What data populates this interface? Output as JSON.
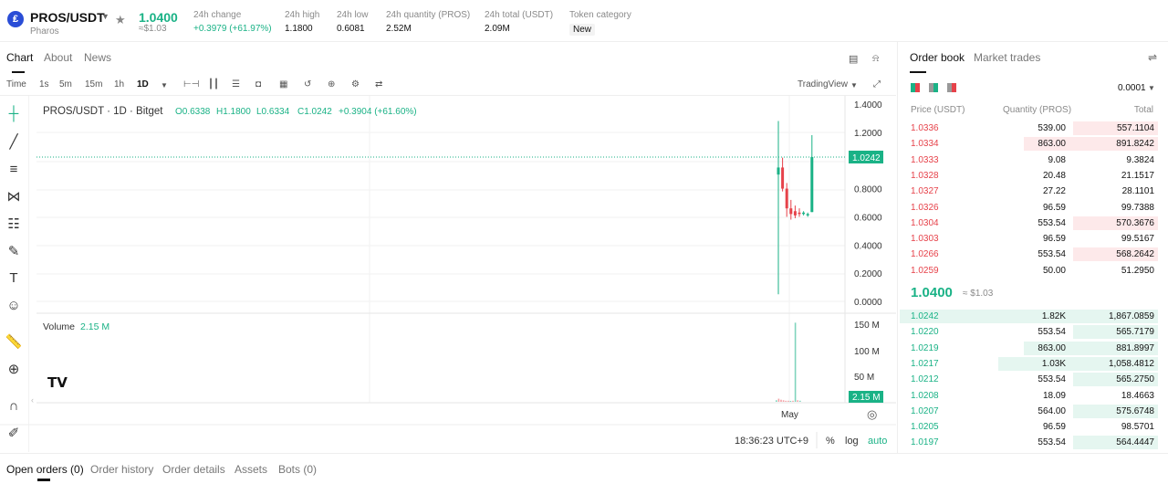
{
  "header": {
    "pair": "PROS/USDT",
    "network": "Pharos",
    "last_price": "1.0400",
    "last_price_usd": "≈$1.03",
    "stats": [
      {
        "label": "24h change",
        "value": "+0.3979 (+61.97%)"
      },
      {
        "label": "24h high",
        "value": "1.1800"
      },
      {
        "label": "24h low",
        "value": "0.6081"
      },
      {
        "label": "24h quantity (PROS)",
        "value": "2.52M"
      },
      {
        "label": "24h total (USDT)",
        "value": "2.09M"
      }
    ],
    "token_category_label": "Token category",
    "token_category_value": "New"
  },
  "chart_tabs": [
    "Chart",
    "About",
    "News"
  ],
  "toolbar": {
    "intervals": [
      "Time",
      "1s",
      "5m",
      "15m",
      "1h",
      "1D"
    ],
    "selected": "1D",
    "tradingview": "TradingView"
  },
  "chart": {
    "legend": {
      "symbol": "PROS/USDT · 1D · Bitget",
      "o": "O0.6338",
      "h": "H1.1800",
      "l": "L0.6334",
      "c": "C1.0242",
      "change": "+0.3904 (+61.60%)"
    },
    "price_ticks": [
      "1.4000",
      "1.2000",
      "1.0242",
      "0.8000",
      "0.6000",
      "0.4000",
      "0.2000",
      "0.0000"
    ],
    "last_price_tag": "1.0242",
    "volume_label": "Volume",
    "volume_value": "2.15 M",
    "volume_ticks": [
      "150 M",
      "100 M",
      "50 M"
    ],
    "volume_tag": "2.15 M",
    "x_label": "May",
    "time": "18:36:23 UTC+9",
    "controls": [
      "%",
      "log",
      "auto"
    ]
  },
  "chart_data": {
    "type": "candlestick",
    "ylim": [
      0,
      1.4
    ],
    "candles": [
      {
        "o": 0.9,
        "h": 1.28,
        "l": 0.05,
        "c": 0.95,
        "dir": "up"
      },
      {
        "o": 0.95,
        "h": 1.02,
        "l": 0.78,
        "c": 0.8,
        "dir": "down"
      },
      {
        "o": 0.8,
        "h": 0.84,
        "l": 0.6,
        "c": 0.66,
        "dir": "down"
      },
      {
        "o": 0.66,
        "h": 0.72,
        "l": 0.58,
        "c": 0.62,
        "dir": "down"
      },
      {
        "o": 0.64,
        "h": 0.68,
        "l": 0.59,
        "c": 0.61,
        "dir": "down"
      },
      {
        "o": 0.63,
        "h": 0.66,
        "l": 0.6,
        "c": 0.62,
        "dir": "down"
      },
      {
        "o": 0.62,
        "h": 0.64,
        "l": 0.61,
        "c": 0.63,
        "dir": "up"
      },
      {
        "o": 0.61,
        "h": 0.63,
        "l": 0.6,
        "c": 0.62,
        "dir": "up"
      },
      {
        "o": 0.6338,
        "h": 1.18,
        "l": 0.6334,
        "c": 1.0242,
        "dir": "up"
      }
    ],
    "volume_m": [
      3,
      6,
      4,
      3,
      2,
      2,
      1.5,
      2,
      152,
      3,
      2.15
    ],
    "volume_dir": [
      "up",
      "down",
      "down",
      "down",
      "down",
      "down",
      "up",
      "down",
      "up",
      "down",
      "up"
    ]
  },
  "orderbook": {
    "tabs": [
      "Order book",
      "Market trades"
    ],
    "precision": "0.0001",
    "headers": {
      "price": "Price (USDT)",
      "qty": "Quantity (PROS)",
      "total": "Total"
    },
    "asks": [
      {
        "price": "1.0336",
        "qty": "539.00",
        "total": "557.1104",
        "depth": 0.33
      },
      {
        "price": "1.0334",
        "qty": "863.00",
        "total": "891.8242",
        "depth": 0.52
      },
      {
        "price": "1.0333",
        "qty": "9.08",
        "total": "9.3824",
        "depth": 0
      },
      {
        "price": "1.0328",
        "qty": "20.48",
        "total": "21.1517",
        "depth": 0
      },
      {
        "price": "1.0327",
        "qty": "27.22",
        "total": "28.1101",
        "depth": 0
      },
      {
        "price": "1.0326",
        "qty": "96.59",
        "total": "99.7388",
        "depth": 0
      },
      {
        "price": "1.0304",
        "qty": "553.54",
        "total": "570.3676",
        "depth": 0.33
      },
      {
        "price": "1.0303",
        "qty": "96.59",
        "total": "99.5167",
        "depth": 0
      },
      {
        "price": "1.0266",
        "qty": "553.54",
        "total": "568.2642",
        "depth": 0.33
      },
      {
        "price": "1.0259",
        "qty": "50.00",
        "total": "51.2950",
        "depth": 0
      }
    ],
    "mid_price": "1.0400",
    "mid_price_usd": "≈ $1.03",
    "bids": [
      {
        "price": "1.0242",
        "qty": "1.82K",
        "total": "1,867.0859",
        "depth": 1.0
      },
      {
        "price": "1.0220",
        "qty": "553.54",
        "total": "565.7179",
        "depth": 0.33
      },
      {
        "price": "1.0219",
        "qty": "863.00",
        "total": "881.8997",
        "depth": 0.52
      },
      {
        "price": "1.0217",
        "qty": "1.03K",
        "total": "1,058.4812",
        "depth": 0.62
      },
      {
        "price": "1.0212",
        "qty": "553.54",
        "total": "565.2750",
        "depth": 0.33
      },
      {
        "price": "1.0208",
        "qty": "18.09",
        "total": "18.4663",
        "depth": 0
      },
      {
        "price": "1.0207",
        "qty": "564.00",
        "total": "575.6748",
        "depth": 0.33
      },
      {
        "price": "1.0205",
        "qty": "96.59",
        "total": "98.5701",
        "depth": 0
      },
      {
        "price": "1.0197",
        "qty": "553.54",
        "total": "564.4447",
        "depth": 0.33
      }
    ]
  },
  "bottom_tabs": [
    "Open orders (0)",
    "Order history",
    "Order details",
    "Assets",
    "Bots (0)"
  ],
  "colors": {
    "up": "#1ab286",
    "down": "#e6424a"
  }
}
